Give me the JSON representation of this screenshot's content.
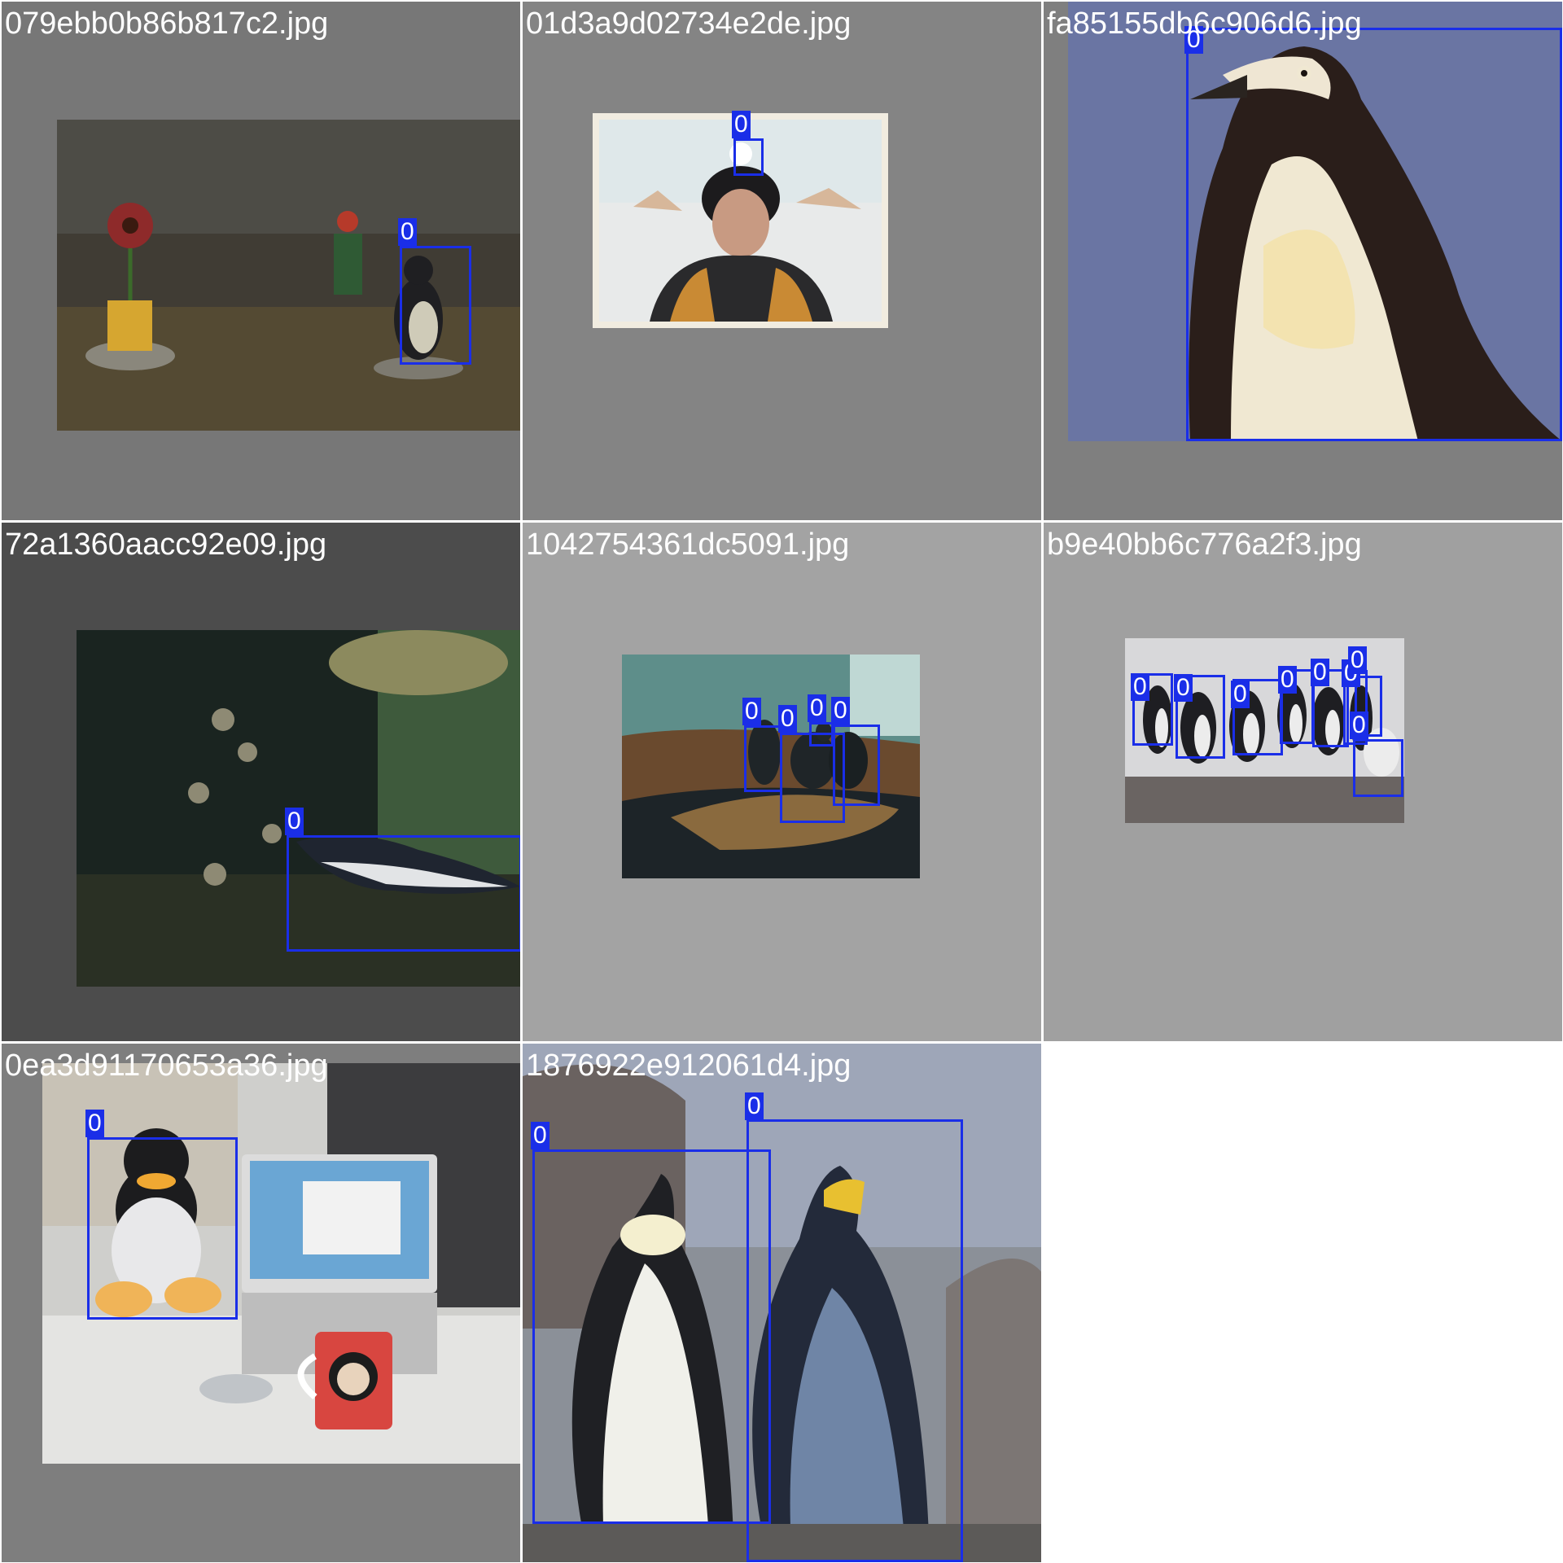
{
  "grid": {
    "background": "#ffffff",
    "box_color": "#1a2ee8",
    "cells": [
      {
        "filename": "079ebb0b86b817c2.jpg",
        "text_color": "#ffffff",
        "labels": [
          "0"
        ]
      },
      {
        "filename": "01d3a9d02734e2de.jpg",
        "text_color": "#ffffff",
        "labels": [
          "0"
        ]
      },
      {
        "filename": "fa85155db6c906d6.jpg",
        "text_color": "#ffffff",
        "labels": [
          "0"
        ]
      },
      {
        "filename": "72a1360aacc92e09.jpg",
        "text_color": "#ffffff",
        "labels": [
          "0"
        ]
      },
      {
        "filename": "1042754361dc5091.jpg",
        "text_color": "#ffffff",
        "labels": [
          "0",
          "0",
          "0",
          "0"
        ]
      },
      {
        "filename": "b9e40bb6c776a2f3.jpg",
        "text_color": "#ffffff",
        "labels": [
          "0",
          "0",
          "0",
          "0",
          "0",
          "0",
          "0",
          "0"
        ]
      },
      {
        "filename": "0ea3d91170653a36.jpg",
        "text_color": "#ffffff",
        "labels": [
          "0"
        ]
      },
      {
        "filename": "1876922e912061d4.jpg",
        "text_color": "#ffffff",
        "labels": [
          "0",
          "0"
        ]
      }
    ]
  }
}
